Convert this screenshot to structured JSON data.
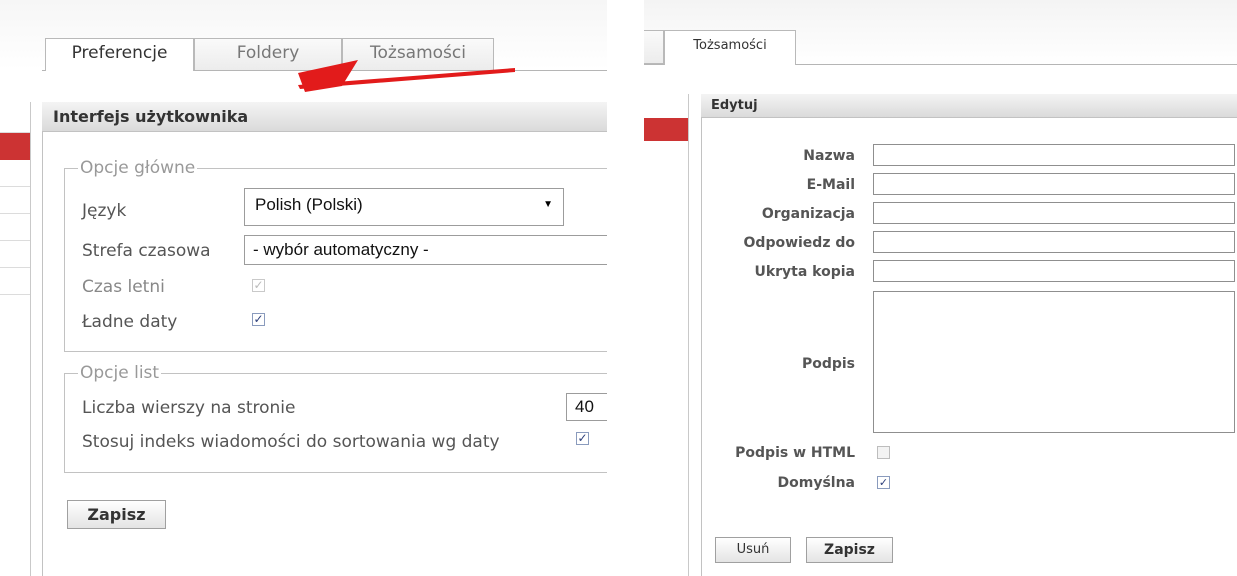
{
  "left": {
    "tabs": [
      "Preferencje",
      "Foldery",
      "Tożsamości"
    ],
    "section_title": "Interfejs użytkownika",
    "main_options": {
      "legend": "Opcje główne",
      "language_label": "Język",
      "language_value": "Polish (Polski)",
      "timezone_label": "Strefa czasowa",
      "timezone_value": "- wybór automatyczny -",
      "dst_label": "Czas letni",
      "pretty_dates_label": "Ładne daty"
    },
    "list_options": {
      "legend": "Opcje list",
      "rows_label": "Liczba wierszy na stronie",
      "rows_value": "40",
      "index_sort_label": "Stosuj indeks wiadomości do sortowania wg daty"
    },
    "save_label": "Zapisz"
  },
  "right": {
    "tab": "Tożsamości",
    "section_title": "Edytuj",
    "fields": {
      "name_label": "Nazwa",
      "email_label": "E-Mail",
      "org_label": "Organizacja",
      "reply_label": "Odpowiedz do",
      "bcc_label": "Ukryta kopia",
      "signature_label": "Podpis",
      "html_sig_label": "Podpis w HTML",
      "default_label": "Domyślna"
    },
    "delete_label": "Usuń",
    "save_label": "Zapisz"
  },
  "colors": {
    "accent": "#cc3333",
    "arrow": "#e21b1b"
  }
}
